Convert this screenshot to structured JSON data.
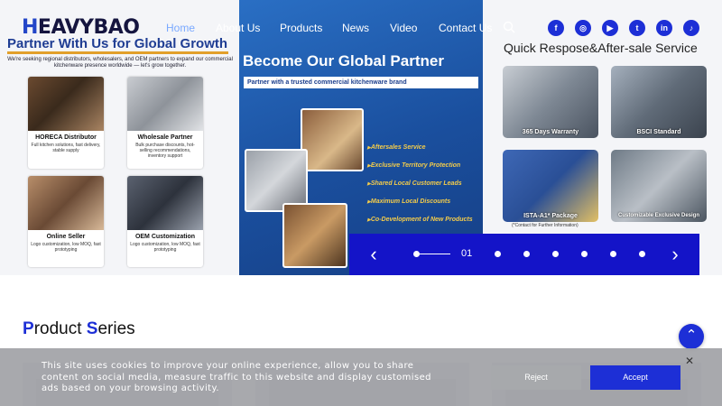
{
  "header": {
    "logo_first": "H",
    "logo_rest": "EAVYBAO",
    "nav": [
      {
        "label": "Home",
        "active": true
      },
      {
        "label": "About Us",
        "active": false
      },
      {
        "label": "Products",
        "active": false
      },
      {
        "label": "News",
        "active": false
      },
      {
        "label": "Video",
        "active": false
      },
      {
        "label": "Contact Us",
        "active": false
      }
    ],
    "search_icon": "search-icon",
    "social": [
      {
        "name": "facebook-icon",
        "glyph": "f"
      },
      {
        "name": "instagram-icon",
        "glyph": "◎"
      },
      {
        "name": "youtube-icon",
        "glyph": "▶"
      },
      {
        "name": "twitter-icon",
        "glyph": "t"
      },
      {
        "name": "linkedin-icon",
        "glyph": "in"
      },
      {
        "name": "tiktok-icon",
        "glyph": "♪"
      }
    ]
  },
  "banner": {
    "left": {
      "title": "Partner With Us for Global Growth",
      "subtitle": "We're seeking regional distributors, wholesalers, and OEM partners to expand our commercial kitchenware presence worldwide — let's grow together.",
      "cards": [
        {
          "title": "HORECA Distributor",
          "desc": "Full kitchen solutions, fast delivery, stable supply"
        },
        {
          "title": "Wholesale Partner",
          "desc": "Bulk purchase discounts, hot-selling recommendations, inventory support"
        },
        {
          "title": "Online Seller",
          "desc": "Logo customization, low MOQ, fast prototyping"
        },
        {
          "title": "OEM Customization",
          "desc": "Logo customization, low MOQ, fast prototyping"
        }
      ]
    },
    "middle": {
      "title": "Become Our Global Partner",
      "subtitle": "Partner with a trusted commercial kitchenware brand",
      "benefits": [
        "Aftersales Service",
        "Exclusive Territory Protection",
        "Shared Local Customer Leads",
        "Maximum Local Discounts",
        "Co-Development of New Products"
      ]
    },
    "right": {
      "title": "Quick Respose&After-sale Service",
      "cards": [
        {
          "label": "365 Days Warranty"
        },
        {
          "label": "BSCI Standard"
        },
        {
          "label": "ISTA-A1* Package"
        },
        {
          "label": "Customizable Exclusive Design"
        }
      ],
      "note": "(*Contact for Further Information)"
    },
    "slider": {
      "current": "01",
      "prev_icon": "chevron-left-icon",
      "next_icon": "chevron-right-icon",
      "dot_count": 6
    }
  },
  "products": {
    "title_p": "P",
    "title_rest1": "roduct ",
    "title_s": "S",
    "title_rest2": "eries"
  },
  "cookie": {
    "text": "This site uses cookies to improve your online experience, allow you to share content on social media, measure traffic to this website and display customised ads based on your browsing activity.",
    "reject": "Reject",
    "accept": "Accept"
  },
  "colors": {
    "brand_blue": "#1d2fd6",
    "title_blue": "#1f3d93",
    "accent_gold": "#f4cc4a"
  }
}
